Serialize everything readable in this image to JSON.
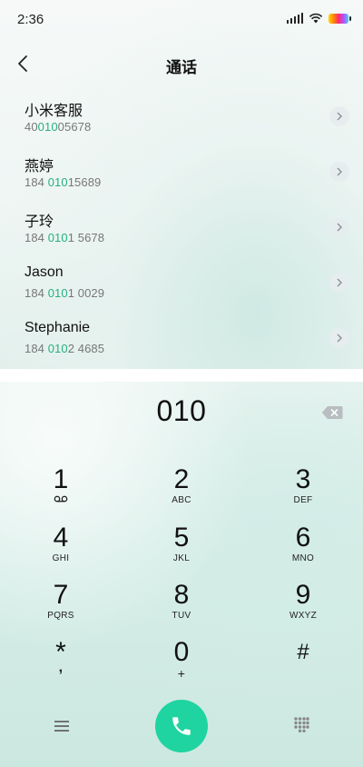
{
  "status_bar": {
    "time": "2:36",
    "icons": [
      "signal-icon",
      "wifi-icon",
      "battery-icon"
    ]
  },
  "header": {
    "title": "通话",
    "back_icon": "chevron-left-icon"
  },
  "contacts": [
    {
      "name": "小米客服",
      "number_pre": "40",
      "number_hl": "010",
      "number_post": "05678"
    },
    {
      "name": "燕婷",
      "number_pre": "184 ",
      "number_hl": "010",
      "number_post": "15689"
    },
    {
      "name": "子玲",
      "number_pre": "184 ",
      "number_hl": "010",
      "number_post": "1 5678"
    },
    {
      "name": "Jason",
      "number_pre": "184 ",
      "number_hl": "010",
      "number_post": "1 0029"
    },
    {
      "name": "Stephanie",
      "number_pre": "184 ",
      "number_hl": "010",
      "number_post": "2 4685"
    }
  ],
  "dialer": {
    "display": "010",
    "keys": [
      {
        "digit": "1",
        "sub": "",
        "sub_icon": "voicemail-icon"
      },
      {
        "digit": "2",
        "sub": "ABC"
      },
      {
        "digit": "3",
        "sub": "DEF"
      },
      {
        "digit": "4",
        "sub": "GHI"
      },
      {
        "digit": "5",
        "sub": "JKL"
      },
      {
        "digit": "6",
        "sub": "MNO"
      },
      {
        "digit": "7",
        "sub": "PQRS"
      },
      {
        "digit": "8",
        "sub": "TUV"
      },
      {
        "digit": "9",
        "sub": "WXYZ"
      },
      {
        "digit": "*",
        "sub": ","
      },
      {
        "digit": "0",
        "sub": "+"
      },
      {
        "digit": "#",
        "sub": ""
      }
    ]
  },
  "colors": {
    "highlight": "#26b07f",
    "call_button": "#1fd4a0"
  }
}
